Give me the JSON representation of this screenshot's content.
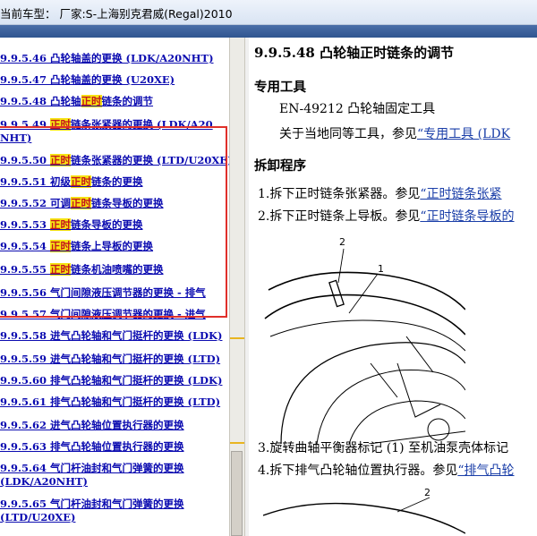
{
  "titlebar": {
    "text": "当前车型： 厂家:S-上海别克君威(Regal)2010"
  },
  "toc": {
    "items": [
      {
        "pre": "9.9.5.46 凸轮轴盖的更换 (LDK/A20NHT)",
        "hl": "",
        "post": ""
      },
      {
        "pre": "9.9.5.47 凸轮轴盖的更换 (U20XE)",
        "hl": "",
        "post": ""
      },
      {
        "pre": "9.9.5.48 凸轮轴",
        "hl": "正时",
        "post": "链条的调节"
      },
      {
        "pre": "9.9.5.49 ",
        "hl": "正时",
        "post": "链条张紧器的更换 (LDK/A20 NHT)"
      },
      {
        "pre": "9.9.5.50 ",
        "hl": "正时",
        "post": "链条张紧器的更换 (LTD/U20XE)"
      },
      {
        "pre": "9.9.5.51 初级",
        "hl": "正时",
        "post": "链条的更换"
      },
      {
        "pre": "9.9.5.52 可调",
        "hl": "正时",
        "post": "链条导板的更换"
      },
      {
        "pre": "9.9.5.53 ",
        "hl": "正时",
        "post": "链条导板的更换"
      },
      {
        "pre": "9.9.5.54 ",
        "hl": "正时",
        "post": "链条上导板的更换"
      },
      {
        "pre": "9.9.5.55 ",
        "hl": "正时",
        "post": "链条机油喷嘴的更换"
      },
      {
        "pre": "9.9.5.56 气门间隙液压调节器的更换 - 排气",
        "hl": "",
        "post": ""
      },
      {
        "pre": "9.9.5.57 气门间隙液压调节器的更换 - 进气",
        "hl": "",
        "post": ""
      },
      {
        "pre": "9.9.5.58 进气凸轮轴和气门挺杆的更换 (LDK)",
        "hl": "",
        "post": ""
      },
      {
        "pre": "9.9.5.59 进气凸轮轴和气门挺杆的更换 (LTD)",
        "hl": "",
        "post": ""
      },
      {
        "pre": "9.9.5.60 排气凸轮轴和气门挺杆的更换 (LDK)",
        "hl": "",
        "post": ""
      },
      {
        "pre": "9.9.5.61 排气凸轮轴和气门挺杆的更换 (LTD)",
        "hl": "",
        "post": ""
      },
      {
        "pre": "9.9.5.62 进气凸轮轴位置执行器的更换",
        "hl": "",
        "post": ""
      },
      {
        "pre": "9.9.5.63 排气凸轮轴位置执行器的更换",
        "hl": "",
        "post": ""
      },
      {
        "pre": "9.9.5.64 气门杆油封和气门弹簧的更换 (LDK/A20NHT)",
        "hl": "",
        "post": ""
      },
      {
        "pre": "9.9.5.65 气门杆油封和气门弹簧的更换 (LTD/U20XE)",
        "hl": "",
        "post": ""
      }
    ]
  },
  "doc": {
    "title": "9.9.5.48 凸轮轴正时链条的调节",
    "special_tools_heading": "专用工具",
    "tool_line": "EN-49212 凸轮轴固定工具",
    "equiv_prefix": "关于当地同等工具，参见",
    "equiv_link": "“专用工具 (LDK",
    "removal_heading": "拆卸程序",
    "step1_prefix": "1.拆下正时链条张紧器。参见",
    "step1_link": "“正时链条张紧",
    "step2_prefix": "2.拆下正时链条上导板。参见",
    "step2_link": "“正时链条导板的",
    "callout_2": "2",
    "callout_1": "1",
    "step3": "3.旋转曲轴平衡器标记 (1) 至机油泵壳体标记",
    "step4_prefix": "4.拆下排气凸轮轴位置执行器。参见",
    "step4_link": "“排气凸轮",
    "callout_2b": "2"
  },
  "colors": {
    "highlight_bg": "#f6e312",
    "highlight_text": "#c4161c",
    "link": "#0b0bb0",
    "redbox": "#e0302a"
  }
}
